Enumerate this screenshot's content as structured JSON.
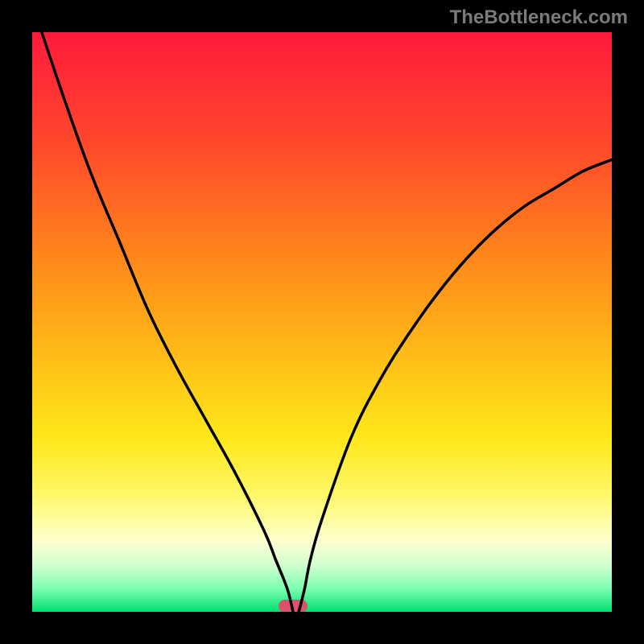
{
  "watermark": "TheBottleneck.com",
  "chart_data": {
    "type": "line",
    "title": "",
    "xlabel": "",
    "ylabel": "",
    "xlim": [
      0,
      100
    ],
    "ylim": [
      0,
      100
    ],
    "background": {
      "type": "gradient_vertical",
      "stops": [
        {
          "pos": 0.0,
          "color": "#ff1a3c"
        },
        {
          "pos": 0.2,
          "color": "#ff4a2a"
        },
        {
          "pos": 0.4,
          "color": "#ff8a1a"
        },
        {
          "pos": 0.55,
          "color": "#ffba18"
        },
        {
          "pos": 0.7,
          "color": "#ffe81a"
        },
        {
          "pos": 0.8,
          "color": "#fff86a"
        },
        {
          "pos": 0.88,
          "color": "#fcffd0"
        },
        {
          "pos": 0.92,
          "color": "#d0ffd0"
        },
        {
          "pos": 0.96,
          "color": "#7affb0"
        },
        {
          "pos": 1.0,
          "color": "#00e070"
        }
      ]
    },
    "series": [
      {
        "name": "bottleneck_curve",
        "color": "#000000",
        "x": [
          0,
          5,
          10,
          15,
          20,
          25,
          30,
          35,
          40,
          42,
          44,
          45,
          46,
          47,
          48,
          50,
          55,
          60,
          65,
          70,
          75,
          80,
          85,
          90,
          95,
          100
        ],
        "values": [
          105,
          90,
          76,
          64,
          52,
          42,
          33,
          24,
          14,
          9,
          4,
          0,
          0,
          4,
          9,
          16,
          30,
          40,
          48,
          55,
          61,
          66,
          70,
          73,
          76,
          78
        ]
      }
    ],
    "marker": {
      "x": 45,
      "y": 1,
      "width": 5,
      "height": 2.2,
      "color": "#d9536b"
    }
  }
}
